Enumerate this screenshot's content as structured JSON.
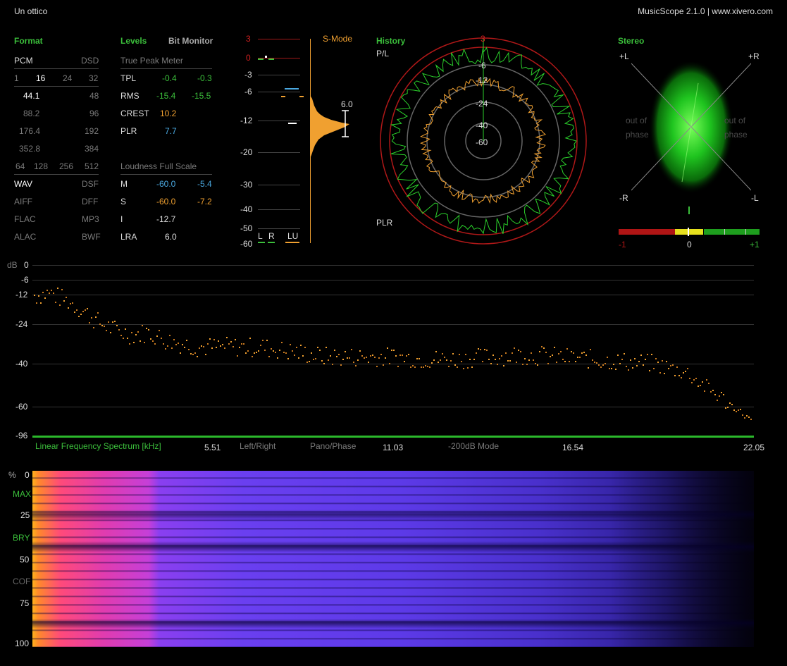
{
  "app": {
    "track_title": "Un ottico",
    "version_text": "MusicScope 2.1.0 | www.xivero.com"
  },
  "format": {
    "header": "Format",
    "pcm": "PCM",
    "dsd": "DSD",
    "bits": [
      "1",
      "16",
      "24",
      "32"
    ],
    "rates_left": [
      "44.1",
      "88.2",
      "176.4",
      "352.8"
    ],
    "rates_right": [
      "48",
      "96",
      "192",
      "384"
    ],
    "dsd_rates": [
      "64",
      "128",
      "256",
      "512"
    ],
    "files_left": [
      "WAV",
      "AIFF",
      "FLAC",
      "ALAC"
    ],
    "files_right": [
      "DSF",
      "DFF",
      "MP3",
      "BWF"
    ]
  },
  "levels": {
    "header": "Levels",
    "bit_monitor": "Bit Monitor",
    "tpm_header": "True Peak Meter",
    "rows": [
      {
        "label": "TPL",
        "l": "-0.4",
        "r": "-0.3"
      },
      {
        "label": "RMS",
        "l": "-15.4",
        "r": "-15.5"
      },
      {
        "label": "CREST",
        "l": "10.2",
        "r": ""
      },
      {
        "label": "PLR",
        "l": "7.7",
        "r": ""
      }
    ],
    "lfs_header": "Loudness Full Scale",
    "loud_rows": [
      {
        "label": "M",
        "a": "-60.0",
        "b": "-5.4"
      },
      {
        "label": "S",
        "a": "-60.0",
        "b": "-7.2"
      },
      {
        "label": "I",
        "a": "-12.7",
        "b": ""
      },
      {
        "label": "LRA",
        "a": "6.0",
        "b": ""
      }
    ]
  },
  "meter": {
    "scale": [
      "3",
      "0",
      "-3",
      "-6",
      "-12",
      "-20",
      "-30",
      "-40",
      "-50",
      "-60"
    ],
    "smode": "S-Mode",
    "lra_value": "6.0",
    "legend_l": "L",
    "legend_r": "R",
    "legend_lu": "LU"
  },
  "history": {
    "header": "History",
    "pl": "P/L",
    "plr": "PLR",
    "rings": [
      "3",
      "-6",
      "-12",
      "-24",
      "-40",
      "-60"
    ]
  },
  "stereo": {
    "header": "Stereo",
    "pl": "+L",
    "pr": "+R",
    "nr": "-R",
    "nl": "-L",
    "out1": "out of",
    "phase1": "phase",
    "out2": "out of",
    "phase2": "phase",
    "corr_min": "-1",
    "corr_mid": "0",
    "corr_max": "+1",
    "correlation": 0.0
  },
  "spectrum": {
    "db_label": "dB",
    "db_ticks": [
      "0",
      "-6",
      "-12",
      "-24",
      "-40",
      "-60",
      "-96"
    ],
    "title": "Linear Frequency Spectrum [kHz]",
    "freq_ticks": [
      "5.51",
      "11.03",
      "16.54",
      "22.05"
    ],
    "mode_left_right": "Left/Right",
    "mode_pano": "Pano/Phase",
    "mode_200db": "-200dB Mode"
  },
  "spectrogram": {
    "pct": "%",
    "ticks": [
      "0",
      "25",
      "50",
      "75",
      "100"
    ],
    "labels": [
      "MAX",
      "BRY",
      "COF"
    ]
  },
  "colors": {
    "green": "#3bbf3b",
    "orange": "#f0a030",
    "blue": "#4aa8e0",
    "red": "#d02020",
    "yellow": "#e8e020"
  },
  "chart_data": {
    "type": "scatter",
    "title": "Linear Frequency Spectrum [kHz]",
    "xlabel": "kHz",
    "ylabel": "dB",
    "xlim": [
      0,
      22.05
    ],
    "ylim": [
      -96,
      0
    ],
    "x": [
      0.1,
      0.5,
      1.0,
      1.5,
      2.0,
      2.5,
      3.0,
      3.5,
      4.0,
      5.0,
      6.0,
      7.0,
      8.0,
      9.0,
      10.0,
      11.0,
      12.0,
      13.0,
      14.0,
      15.0,
      16.0,
      17.0,
      18.0,
      19.0,
      20.0,
      20.5,
      21.0,
      21.5,
      22.0
    ],
    "y": [
      -12,
      -11,
      -14,
      -18,
      -23,
      -26,
      -28,
      -27,
      -30,
      -33,
      -33,
      -33,
      -35,
      -37,
      -37,
      -37,
      -38,
      -38,
      -37,
      -36,
      -37,
      -38,
      -39,
      -40,
      -44,
      -50,
      -55,
      -62,
      -78
    ]
  }
}
